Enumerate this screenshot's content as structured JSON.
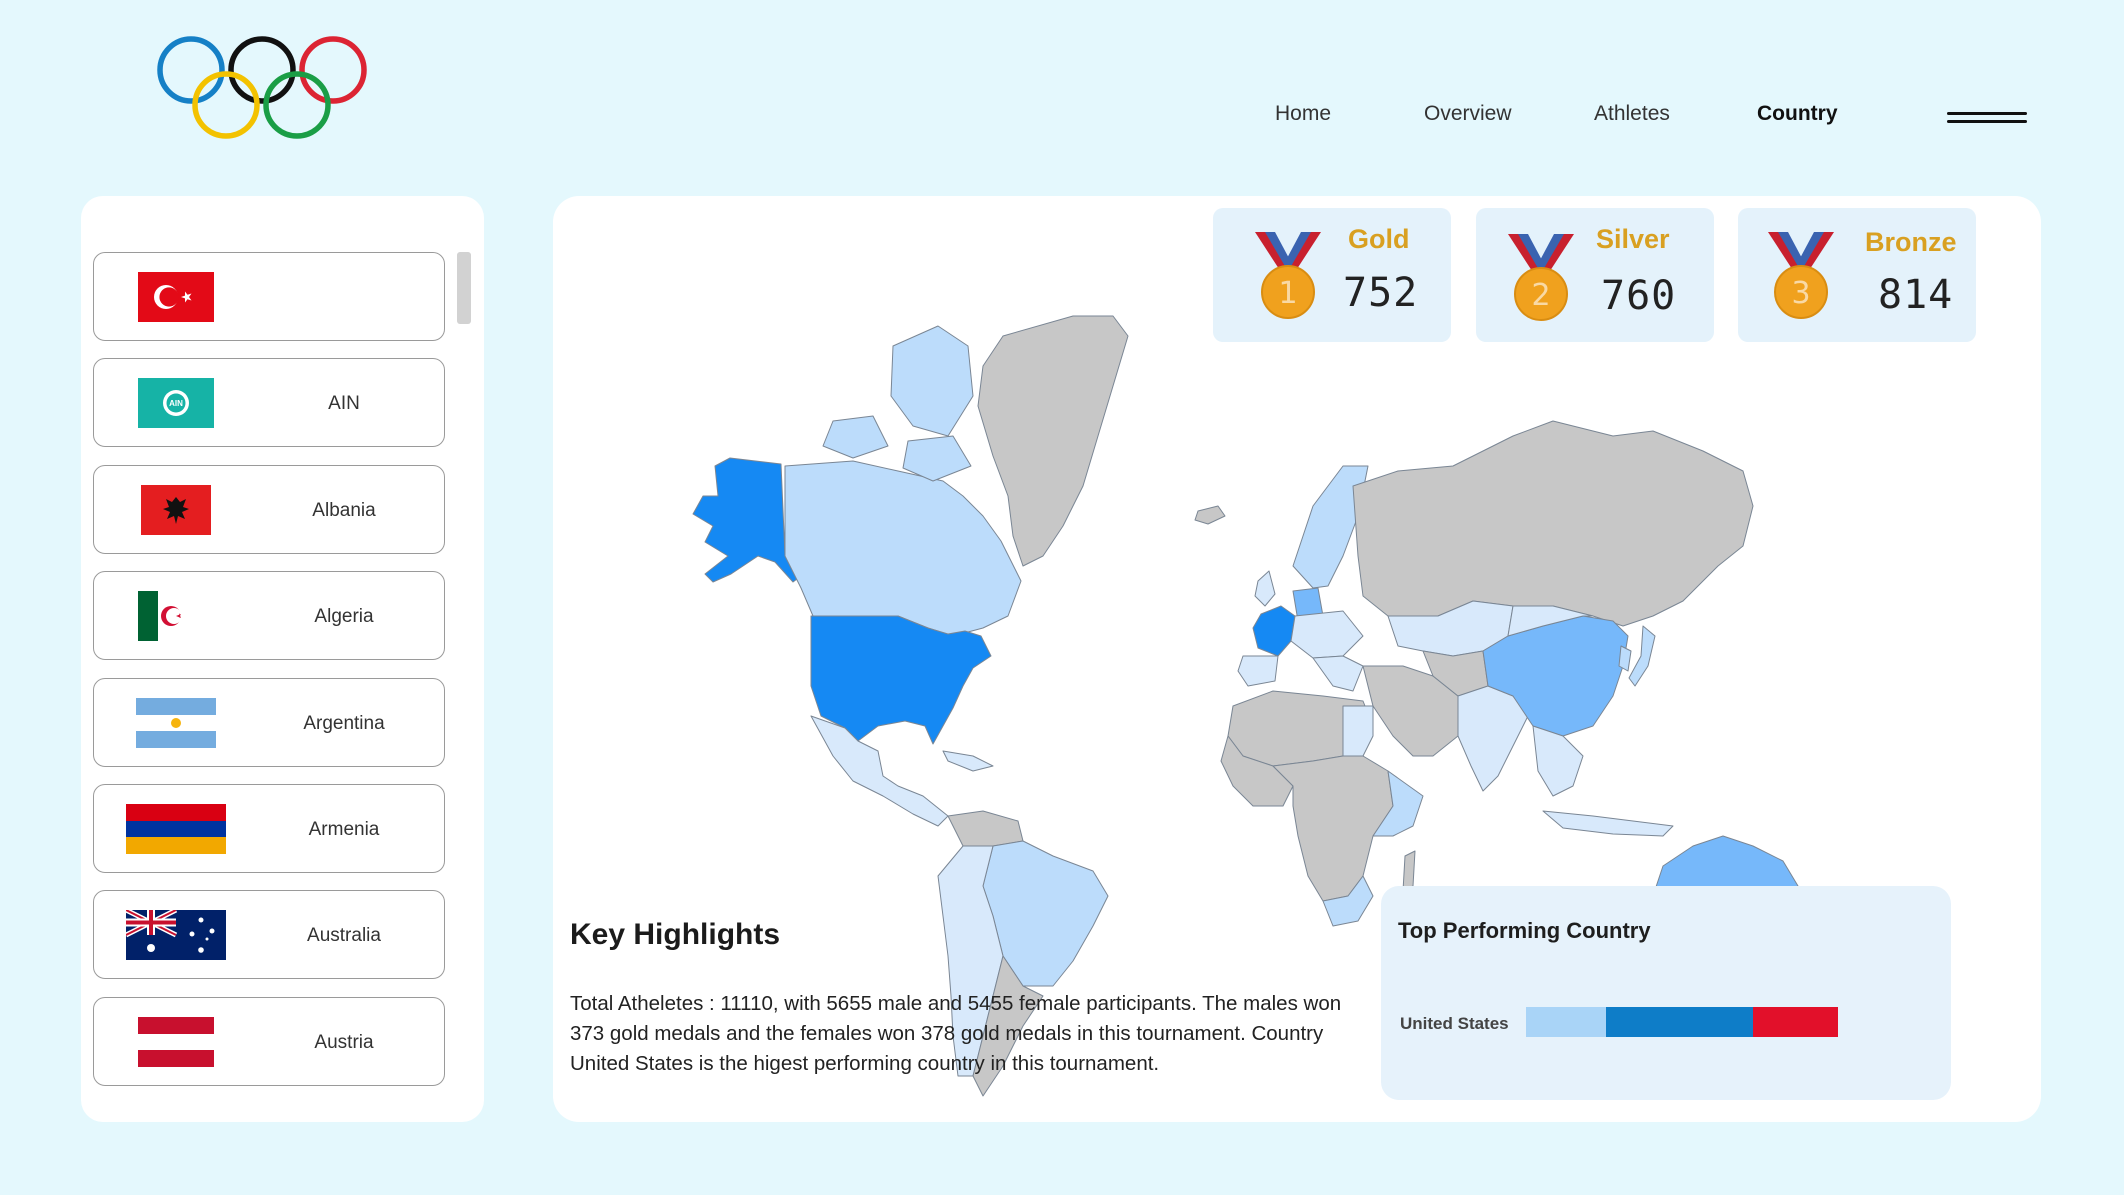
{
  "nav": {
    "items": [
      {
        "label": "Home",
        "active": false
      },
      {
        "label": "Overview",
        "active": false
      },
      {
        "label": "Athletes",
        "active": false
      },
      {
        "label": "Country",
        "active": true
      }
    ]
  },
  "logo": {
    "name": "olympic-rings",
    "colors": [
      "#1580c6",
      "#111111",
      "#dc2433",
      "#f3c200",
      "#1a9e46"
    ]
  },
  "countries": [
    {
      "name": "",
      "flag": "turkey-flag"
    },
    {
      "name": "AIN",
      "flag": "ain-flag"
    },
    {
      "name": "Albania",
      "flag": "albania-flag"
    },
    {
      "name": "Algeria",
      "flag": "algeria-flag"
    },
    {
      "name": "Argentina",
      "flag": "argentina-flag"
    },
    {
      "name": "Armenia",
      "flag": "armenia-flag"
    },
    {
      "name": "Australia",
      "flag": "australia-flag"
    },
    {
      "name": "Austria",
      "flag": "austria-flag"
    }
  ],
  "medals": {
    "gold": {
      "label": "Gold",
      "count": "752",
      "rank": "1"
    },
    "silver": {
      "label": "Silver",
      "count": "760",
      "rank": "2"
    },
    "bronze": {
      "label": "Bronze",
      "count": "814",
      "rank": "3"
    }
  },
  "key_highlights": {
    "title": "Key Highlights",
    "text": "Total Atheletes : 11110, with 5655 male and 5455 female participants. The males won 373 gold medals and the females won 378 gold medals in this tournament. Country United States is the higest performing country in this tournament."
  },
  "top_performing": {
    "title": "Top Performing Country",
    "country": "United States",
    "segments": [
      {
        "name": "gold",
        "share": 0.216,
        "color": "#a9d4f7"
      },
      {
        "name": "silver",
        "share": 0.4,
        "color": "#0e7dc8"
      },
      {
        "name": "bronze",
        "share": 0.23,
        "color": "#e2102a"
      }
    ]
  },
  "map_colors": {
    "top": "#1589f3",
    "high": "#76b8fa",
    "mid": "#bcdcfb",
    "low": "#d8e9fb",
    "none": "#c7c7c7"
  }
}
